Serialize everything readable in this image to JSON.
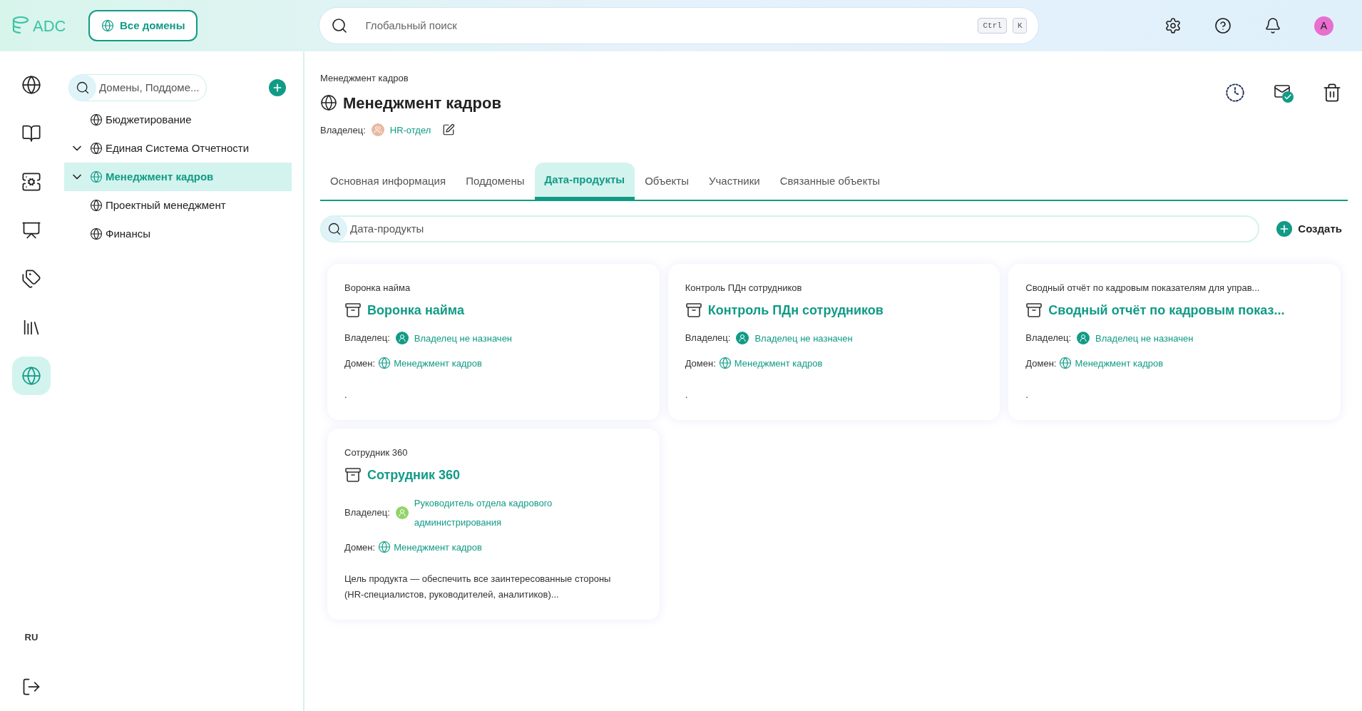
{
  "header": {
    "logo": "ADC",
    "all_domains_button": "Все домены",
    "search": {
      "placeholder": "Глобальный поиск",
      "shortcut": [
        "Ctrl",
        "K"
      ]
    },
    "avatar": "A"
  },
  "rail": {
    "items": [
      {
        "kind": "globe-search",
        "selected": false
      },
      {
        "kind": "book",
        "selected": false
      },
      {
        "kind": "server-star",
        "selected": false
      },
      {
        "kind": "monitor",
        "selected": false
      },
      {
        "kind": "tags",
        "selected": false
      },
      {
        "kind": "library",
        "selected": false
      },
      {
        "kind": "globe",
        "selected": true
      }
    ],
    "language": "RU"
  },
  "tree": {
    "search": {
      "placeholder": "Домены, Поддоме..."
    },
    "items": [
      {
        "label": "Бюджетирование",
        "kind": "leaf",
        "selected": false
      },
      {
        "label": "Единая Система Отчетности",
        "kind": "branch",
        "expanded": true,
        "selected": false
      },
      {
        "label": "Менеджмент кадров",
        "kind": "branch",
        "expanded": true,
        "selected": true
      },
      {
        "label": "Проектный менеджмент",
        "kind": "leaf",
        "selected": false
      },
      {
        "label": "Финансы",
        "kind": "leaf",
        "selected": false
      }
    ]
  },
  "page": {
    "breadcrumb": "Менеджмент кадров",
    "title": "Менеджмент кадров",
    "owner_label": "Владелец:",
    "owner": {
      "name": "HR-отдел",
      "color": "#e8b9a0"
    },
    "tabs": [
      {
        "label": "Основная информация",
        "selected": false
      },
      {
        "label": "Поддомены",
        "selected": false
      },
      {
        "label": "Дата-продукты",
        "selected": true
      },
      {
        "label": "Объекты",
        "selected": false
      },
      {
        "label": "Участники",
        "selected": false
      },
      {
        "label": "Связанные объекты",
        "selected": false
      }
    ],
    "search": {
      "placeholder": "Дата-продукты"
    },
    "create_button": "Создать",
    "cards": [
      {
        "caption": "Воронка найма",
        "title": "Воронка найма",
        "owner_label": "Владелец:",
        "owner": {
          "name": "Владелец не назначен",
          "color": "#119b86"
        },
        "domain_label": "Домен:",
        "domain": "Менеджмент кадров",
        "description": "."
      },
      {
        "caption": "Контроль ПДн сотрудников",
        "title": "Контроль ПДн сотрудников",
        "owner_label": "Владелец:",
        "owner": {
          "name": "Владелец не назначен",
          "color": "#119b86"
        },
        "domain_label": "Домен:",
        "domain": "Менеджмент кадров",
        "description": "."
      },
      {
        "caption": "Сводный отчёт по кадровым показателям для управ...",
        "title": "Сводный отчёт по кадровым показ...",
        "owner_label": "Владелец:",
        "owner": {
          "name": "Владелец не назначен",
          "color": "#119b86"
        },
        "domain_label": "Домен:",
        "domain": "Менеджмент кадров",
        "description": "."
      },
      {
        "caption": "Сотрудник 360",
        "title": "Сотрудник 360",
        "owner_label": "Владелец:",
        "owner": {
          "name": "Руководитель отдела кадрового администрирования",
          "color": "#93d36a"
        },
        "domain_label": "Домен:",
        "domain": "Менеджмент кадров",
        "description": "Цель продукта — обеспечить все заинтересованные стороны (HR-специалистов, руководителей, аналитиков)..."
      }
    ]
  }
}
